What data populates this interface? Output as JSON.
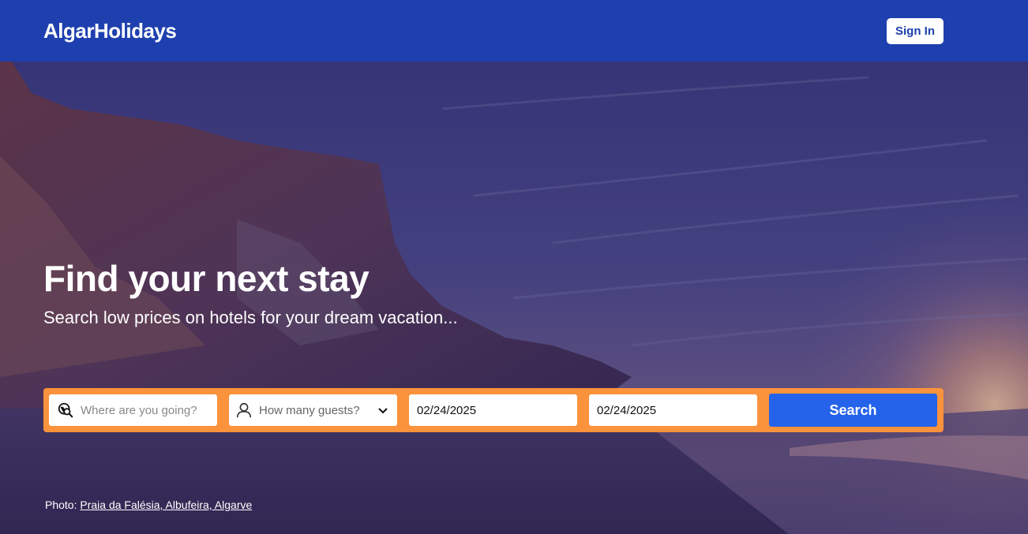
{
  "header": {
    "logo": "AlgarHolidays",
    "signin_label": "Sign In"
  },
  "hero": {
    "title": "Find your next stay",
    "subtitle": "Search low prices on hotels for your dream vacation..."
  },
  "search": {
    "destination_placeholder": "Where are you going?",
    "guests_label": "How many guests?",
    "checkin_value": "02/24/2025",
    "checkout_value": "02/24/2025",
    "button_label": "Search"
  },
  "credit": {
    "prefix": "Photo:",
    "link_text": "Praia da Falésia, Albufeira, Algarve"
  },
  "colors": {
    "header_bg": "#1e40af",
    "search_bar": "#fb923c",
    "search_button": "#2563eb"
  }
}
